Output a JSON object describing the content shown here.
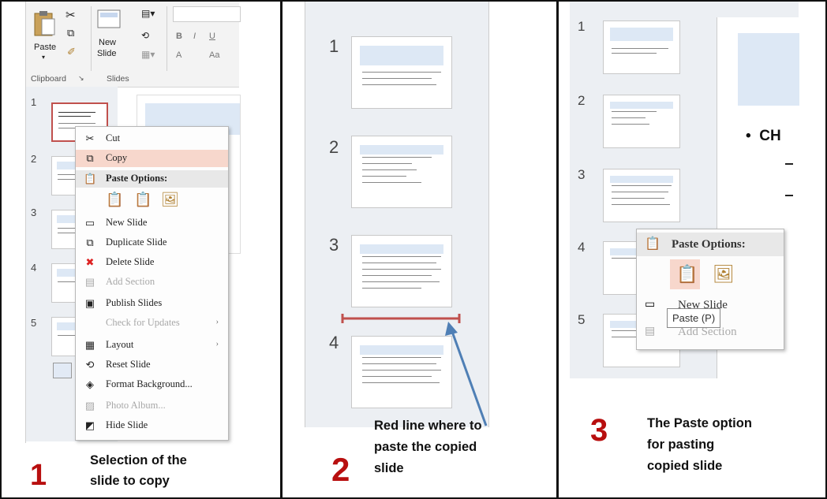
{
  "panel1": {
    "ribbon": {
      "paste": "Paste",
      "new_slide": "New",
      "new_slide2": "Slide",
      "font_b": "B",
      "font_i": "I",
      "font_u": "U",
      "font_a": "A",
      "font_aa": "Aa",
      "clipboard_group": "Clipboard",
      "slides_group": "Slides"
    },
    "slide_numbers": [
      "1",
      "2",
      "3",
      "4",
      "5"
    ],
    "menu": {
      "cut": "Cut",
      "copy": "Copy",
      "paste_options": "Paste Options:",
      "new_slide": "New Slide",
      "duplicate_slide": "Duplicate Slide",
      "delete_slide": "Delete Slide",
      "add_section": "Add Section",
      "publish_slides": "Publish Slides",
      "check_updates": "Check for Updates",
      "layout": "Layout",
      "reset_slide": "Reset Slide",
      "format_background": "Format Background...",
      "photo_album": "Photo Album...",
      "hide_slide": "Hide Slide"
    },
    "step_number": "1",
    "caption_line1": "Selection of the",
    "caption_line2": "slide to copy"
  },
  "panel2": {
    "slide_numbers": [
      "1",
      "2",
      "3",
      "4"
    ],
    "step_number": "2",
    "caption_line1": "Red line where to",
    "caption_line2": "paste the copied",
    "caption_line3": "slide"
  },
  "panel3": {
    "slide_numbers": [
      "1",
      "2",
      "3",
      "4",
      "5"
    ],
    "bullet_text": "CH",
    "paste_options": "Paste Options:",
    "new_slide_partial": "New Slide",
    "tooltip": "Paste (P)",
    "add_section": "Add Section",
    "step_number": "3",
    "caption_line1": "The Paste option",
    "caption_line2": "for pasting",
    "caption_line3": "copied slide"
  },
  "colors": {
    "accent_red": "#b80f0f",
    "selection_border": "#c0504d",
    "menu_highlight": "#f7d7cc",
    "arrow_blue": "#4f7fb5"
  }
}
